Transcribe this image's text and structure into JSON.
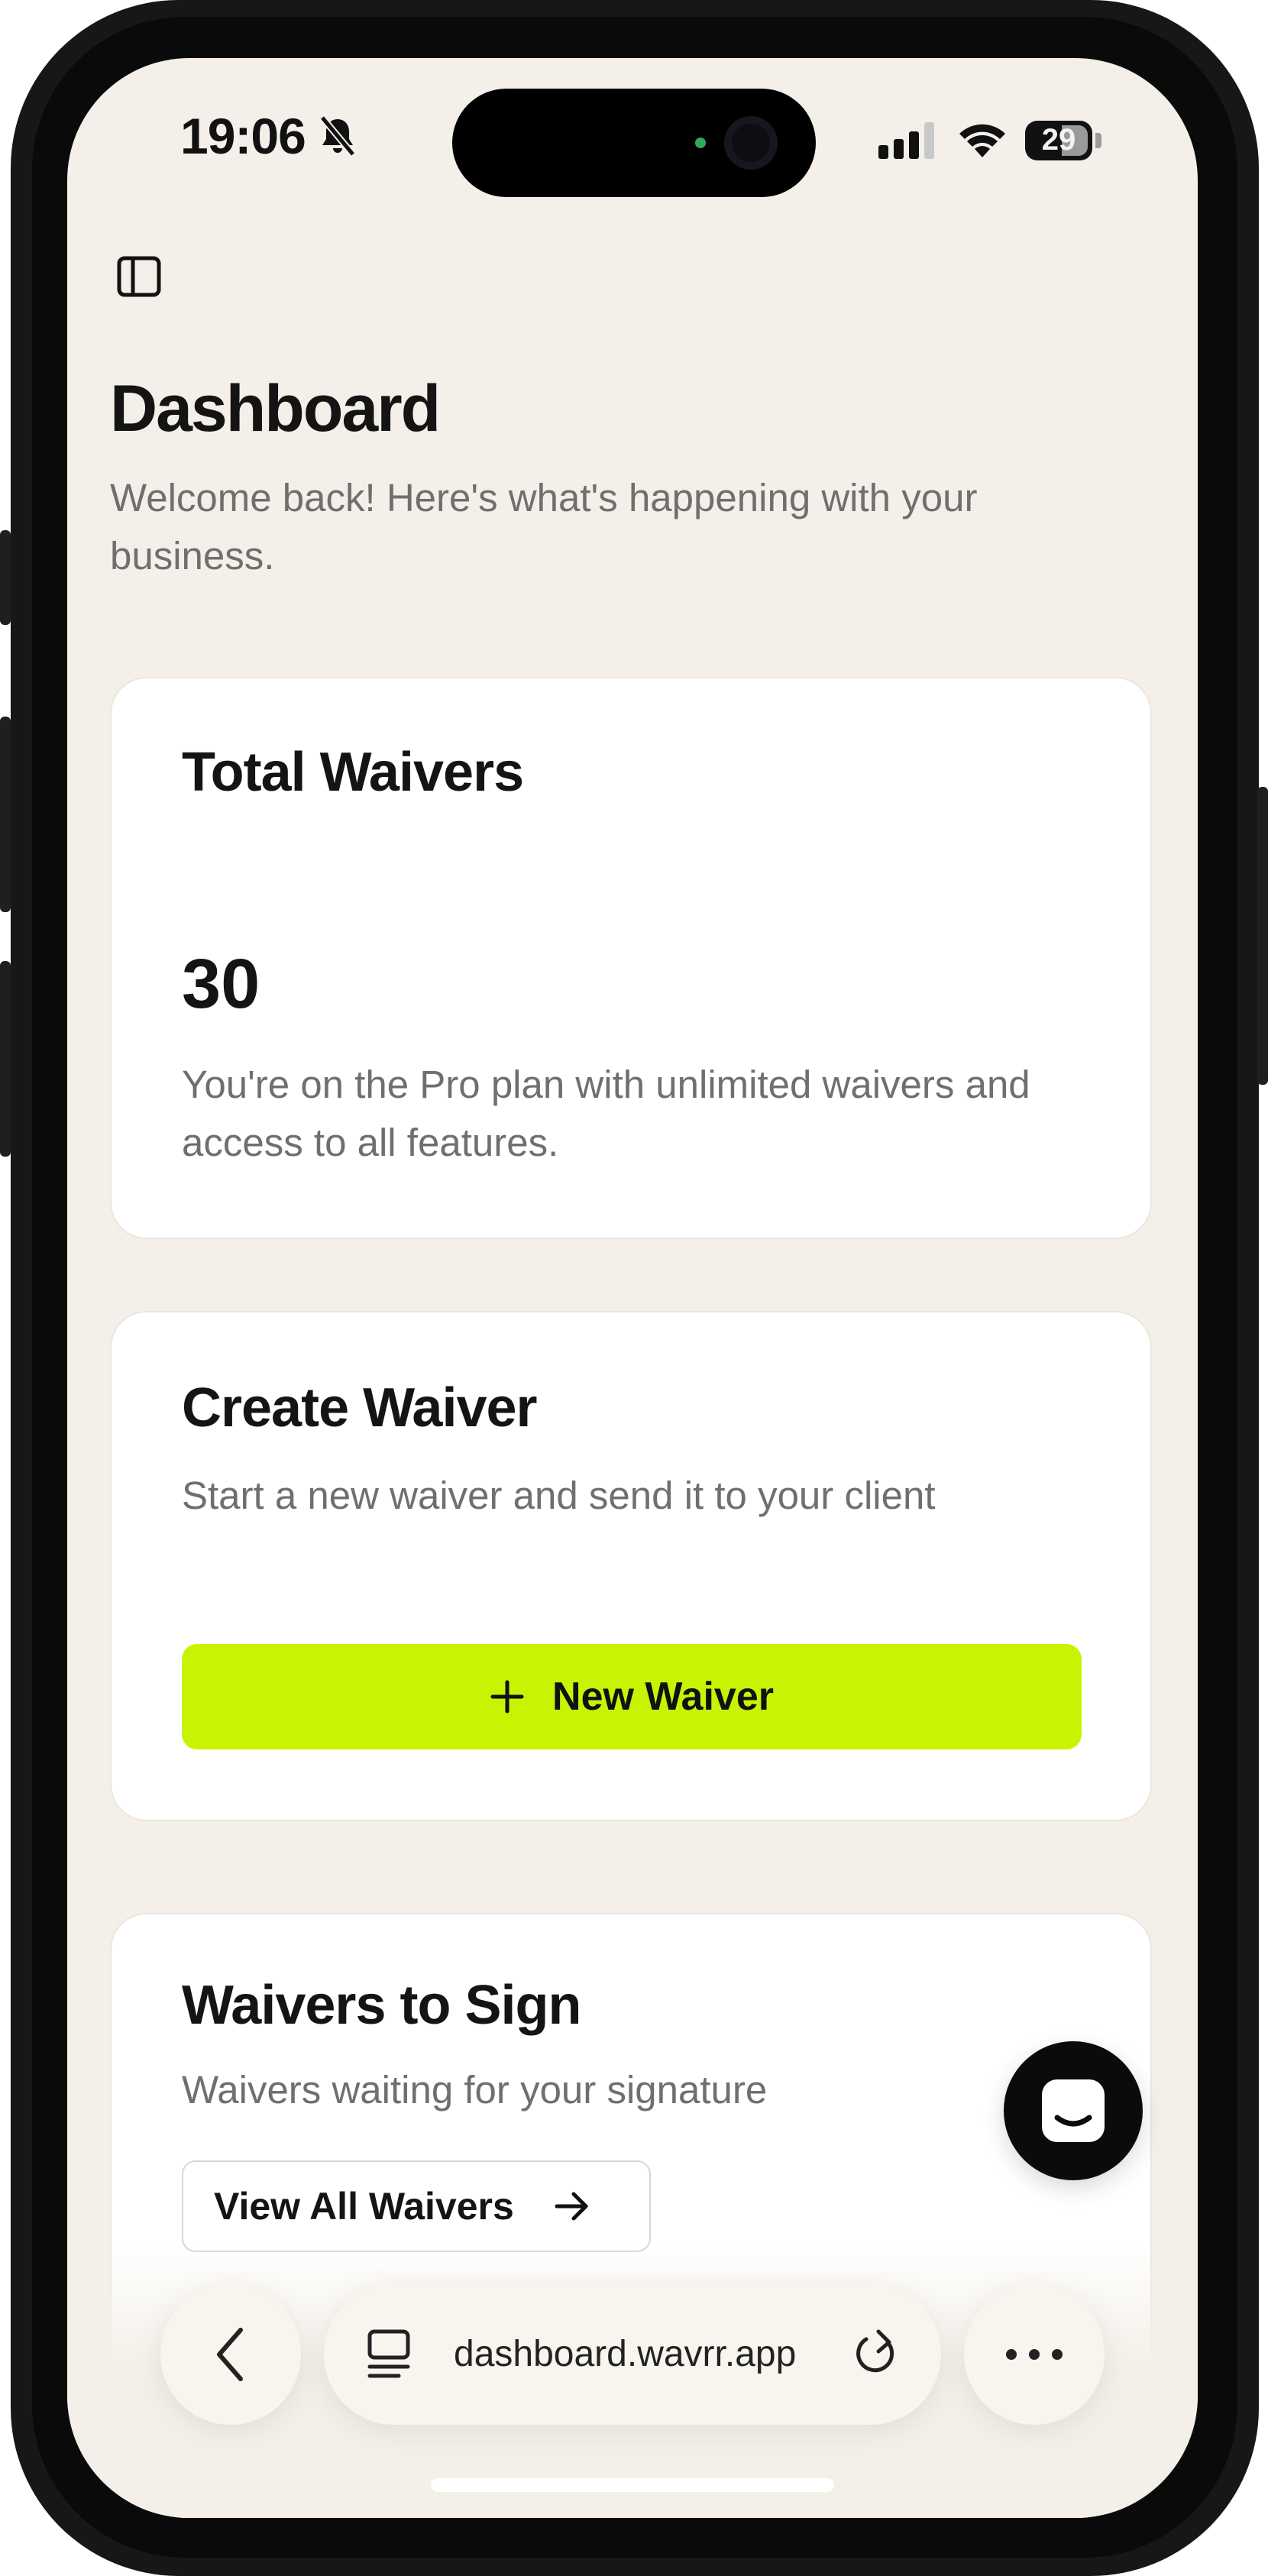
{
  "status_bar": {
    "time": "19:06",
    "battery": "29"
  },
  "page": {
    "title": "Dashboard",
    "subtitle": "Welcome back! Here's what's happening with your business."
  },
  "total_waivers": {
    "title": "Total Waivers",
    "value": "30",
    "description": "You're on the Pro plan with unlimited waivers and access to all features."
  },
  "create_waiver": {
    "title": "Create Waiver",
    "description": "Start a new waiver and send it to your client",
    "button_label": "New Waiver"
  },
  "waivers_to_sign": {
    "title": "Waivers to Sign",
    "description": "Waivers waiting for your signature",
    "button_label": "View All Waivers"
  },
  "browser": {
    "url": "dashboard.wavrr.app"
  },
  "colors": {
    "accent": "#c8f403",
    "background": "#f4f0e9",
    "card": "#ffffff"
  },
  "icons": {
    "sidebar": "sidebar-toggle-icon",
    "plus": "plus-icon",
    "arrow": "arrow-right-icon",
    "chat": "chat-icon",
    "back": "chevron-left-icon",
    "tabs": "tab-overview-icon",
    "reload": "reload-icon",
    "more": "more-icon"
  }
}
